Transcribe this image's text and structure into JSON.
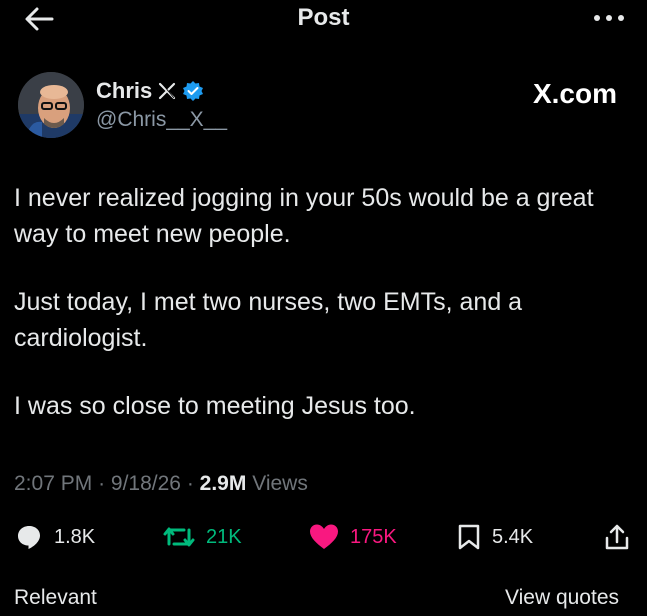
{
  "header": {
    "title": "Post"
  },
  "author": {
    "name": "Chris",
    "handle": "@Chris__X__"
  },
  "source": {
    "label": "X.com"
  },
  "tweet": {
    "paragraphs": [
      "I never realized jogging in your 50s would be a great way to meet new people.",
      "Just today, I met two nurses, two EMTs, and a cardiologist.",
      "I was so close to meeting Jesus too."
    ]
  },
  "meta": {
    "time": "2:07 PM",
    "date": "9/18/26",
    "views_count": "2.9M",
    "views_label": "Views",
    "separator": "·"
  },
  "actions": {
    "replies": "1.8K",
    "reposts": "21K",
    "likes": "175K",
    "bookmarks": "5.4K"
  },
  "footer": {
    "left": "Relevant",
    "right": "View quotes"
  },
  "colors": {
    "background": "#000000",
    "text": "#e7e9ea",
    "muted": "#71767b",
    "repost": "#00ba7c",
    "like": "#f91880",
    "verified": "#1d9bf0"
  },
  "icons": [
    "back-arrow-icon",
    "more-icon",
    "x-logo-icon",
    "verified-badge-icon",
    "reply-icon",
    "repost-icon",
    "heart-icon",
    "bookmark-icon",
    "share-icon"
  ]
}
